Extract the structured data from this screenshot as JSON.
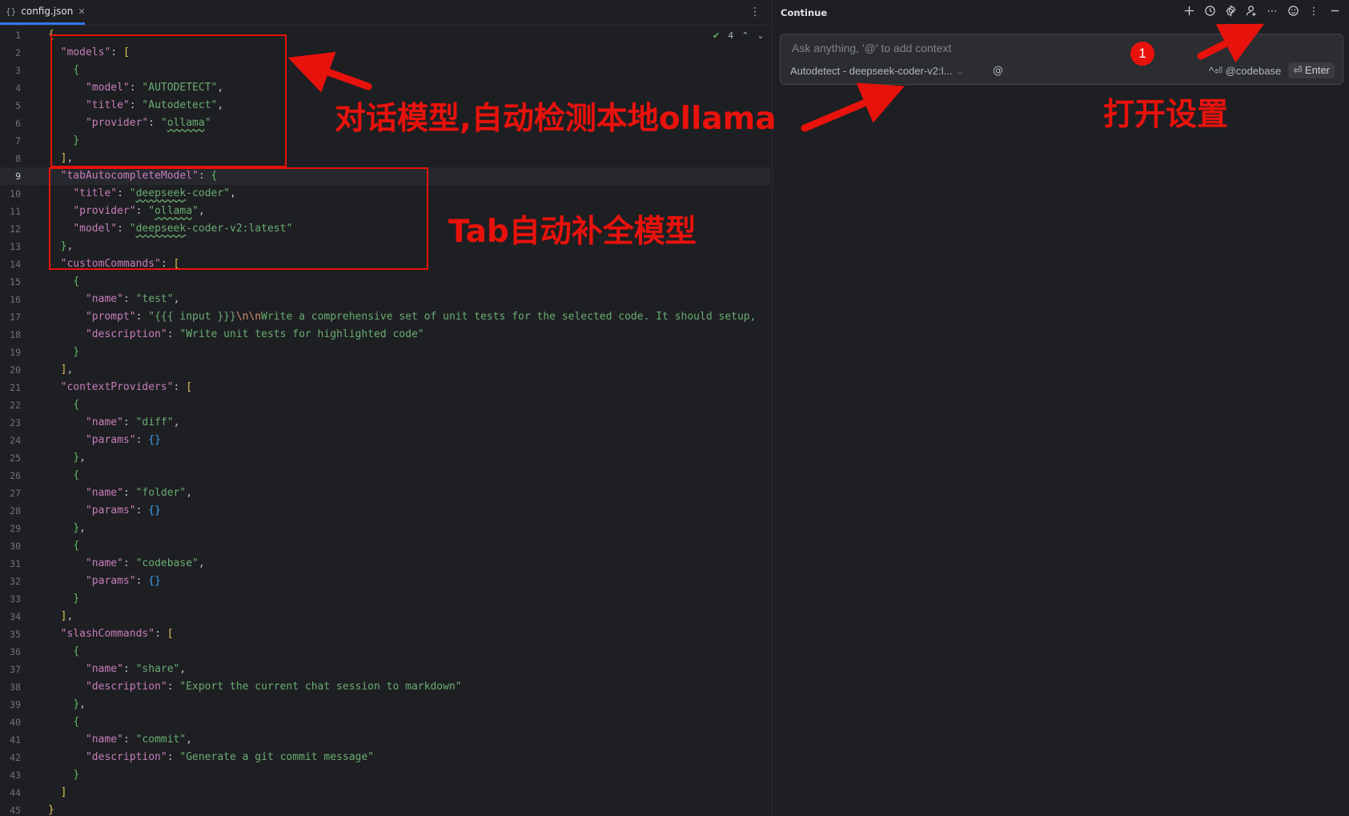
{
  "editor": {
    "tab": {
      "icon": "{}",
      "label": "config.json"
    },
    "inspection": {
      "count": "4"
    },
    "current_line": 9,
    "lines": [
      [
        [
          "b1",
          "{"
        ]
      ],
      [
        [
          "p",
          "  "
        ],
        [
          "k",
          "\"models\""
        ],
        [
          "p",
          ": "
        ],
        [
          "b1",
          "["
        ]
      ],
      [
        [
          "p",
          "    "
        ],
        [
          "b2",
          "{"
        ]
      ],
      [
        [
          "p",
          "      "
        ],
        [
          "k",
          "\"model\""
        ],
        [
          "p",
          ": "
        ],
        [
          "s",
          "\"AUTODETECT\""
        ],
        [
          "p",
          ","
        ]
      ],
      [
        [
          "p",
          "      "
        ],
        [
          "k",
          "\"title\""
        ],
        [
          "p",
          ": "
        ],
        [
          "s",
          "\"Autodetect\""
        ],
        [
          "p",
          ","
        ]
      ],
      [
        [
          "p",
          "      "
        ],
        [
          "k",
          "\"provider\""
        ],
        [
          "p",
          ": "
        ],
        [
          "s",
          "\""
        ],
        [
          "s sq",
          "ollama"
        ],
        [
          "s",
          "\""
        ]
      ],
      [
        [
          "p",
          "    "
        ],
        [
          "b2",
          "}"
        ]
      ],
      [
        [
          "p",
          "  "
        ],
        [
          "b1",
          "]"
        ],
        [
          "p",
          ","
        ]
      ],
      [
        [
          "p",
          "  "
        ],
        [
          "k",
          "\"tabAutocompleteModel\""
        ],
        [
          "p",
          ": "
        ],
        [
          "b2",
          "{"
        ]
      ],
      [
        [
          "p",
          "    "
        ],
        [
          "k",
          "\"title\""
        ],
        [
          "p",
          ": "
        ],
        [
          "s",
          "\""
        ],
        [
          "s sq",
          "deepseek"
        ],
        [
          "s",
          "-coder\""
        ],
        [
          "p",
          ","
        ]
      ],
      [
        [
          "p",
          "    "
        ],
        [
          "k",
          "\"provider\""
        ],
        [
          "p",
          ": "
        ],
        [
          "s",
          "\""
        ],
        [
          "s sq",
          "ollama"
        ],
        [
          "s",
          "\""
        ],
        [
          "p",
          ","
        ]
      ],
      [
        [
          "p",
          "    "
        ],
        [
          "k",
          "\"model\""
        ],
        [
          "p",
          ": "
        ],
        [
          "s",
          "\""
        ],
        [
          "s sq",
          "deepseek"
        ],
        [
          "s",
          "-coder-v2:latest\""
        ]
      ],
      [
        [
          "p",
          "  "
        ],
        [
          "b2",
          "}"
        ],
        [
          "p",
          ","
        ]
      ],
      [
        [
          "p",
          "  "
        ],
        [
          "k",
          "\"customCommands\""
        ],
        [
          "p",
          ": "
        ],
        [
          "b1",
          "["
        ]
      ],
      [
        [
          "p",
          "    "
        ],
        [
          "b2",
          "{"
        ]
      ],
      [
        [
          "p",
          "      "
        ],
        [
          "k",
          "\"name\""
        ],
        [
          "p",
          ": "
        ],
        [
          "s",
          "\"test\""
        ],
        [
          "p",
          ","
        ]
      ],
      [
        [
          "p",
          "      "
        ],
        [
          "k",
          "\"prompt\""
        ],
        [
          "p",
          ": "
        ],
        [
          "s",
          "\"{{{ input }}}"
        ],
        [
          "esc",
          "\\n\\n"
        ],
        [
          "s",
          "Write a comprehensive set of unit tests for the selected code. It should setup,"
        ]
      ],
      [
        [
          "p",
          "      "
        ],
        [
          "k",
          "\"description\""
        ],
        [
          "p",
          ": "
        ],
        [
          "s",
          "\"Write unit tests for highlighted code\""
        ]
      ],
      [
        [
          "p",
          "    "
        ],
        [
          "b2",
          "}"
        ]
      ],
      [
        [
          "p",
          "  "
        ],
        [
          "b1",
          "]"
        ],
        [
          "p",
          ","
        ]
      ],
      [
        [
          "p",
          "  "
        ],
        [
          "k",
          "\"contextProviders\""
        ],
        [
          "p",
          ": "
        ],
        [
          "b1",
          "["
        ]
      ],
      [
        [
          "p",
          "    "
        ],
        [
          "b2",
          "{"
        ]
      ],
      [
        [
          "p",
          "      "
        ],
        [
          "k",
          "\"name\""
        ],
        [
          "p",
          ": "
        ],
        [
          "s",
          "\"diff\""
        ],
        [
          "p",
          ","
        ]
      ],
      [
        [
          "p",
          "      "
        ],
        [
          "k",
          "\"params\""
        ],
        [
          "p",
          ": "
        ],
        [
          "b3",
          "{}"
        ]
      ],
      [
        [
          "p",
          "    "
        ],
        [
          "b2",
          "}"
        ],
        [
          "p",
          ","
        ]
      ],
      [
        [
          "p",
          "    "
        ],
        [
          "b2",
          "{"
        ]
      ],
      [
        [
          "p",
          "      "
        ],
        [
          "k",
          "\"name\""
        ],
        [
          "p",
          ": "
        ],
        [
          "s",
          "\"folder\""
        ],
        [
          "p",
          ","
        ]
      ],
      [
        [
          "p",
          "      "
        ],
        [
          "k",
          "\"params\""
        ],
        [
          "p",
          ": "
        ],
        [
          "b3",
          "{}"
        ]
      ],
      [
        [
          "p",
          "    "
        ],
        [
          "b2",
          "}"
        ],
        [
          "p",
          ","
        ]
      ],
      [
        [
          "p",
          "    "
        ],
        [
          "b2",
          "{"
        ]
      ],
      [
        [
          "p",
          "      "
        ],
        [
          "k",
          "\"name\""
        ],
        [
          "p",
          ": "
        ],
        [
          "s",
          "\"codebase\""
        ],
        [
          "p",
          ","
        ]
      ],
      [
        [
          "p",
          "      "
        ],
        [
          "k",
          "\"params\""
        ],
        [
          "p",
          ": "
        ],
        [
          "b3",
          "{}"
        ]
      ],
      [
        [
          "p",
          "    "
        ],
        [
          "b2",
          "}"
        ]
      ],
      [
        [
          "p",
          "  "
        ],
        [
          "b1",
          "]"
        ],
        [
          "p",
          ","
        ]
      ],
      [
        [
          "p",
          "  "
        ],
        [
          "k",
          "\"slashCommands\""
        ],
        [
          "p",
          ": "
        ],
        [
          "b1",
          "["
        ]
      ],
      [
        [
          "p",
          "    "
        ],
        [
          "b2",
          "{"
        ]
      ],
      [
        [
          "p",
          "      "
        ],
        [
          "k",
          "\"name\""
        ],
        [
          "p",
          ": "
        ],
        [
          "s",
          "\"share\""
        ],
        [
          "p",
          ","
        ]
      ],
      [
        [
          "p",
          "      "
        ],
        [
          "k",
          "\"description\""
        ],
        [
          "p",
          ": "
        ],
        [
          "s",
          "\"Export the current chat session to markdown\""
        ]
      ],
      [
        [
          "p",
          "    "
        ],
        [
          "b2",
          "}"
        ],
        [
          "p",
          ","
        ]
      ],
      [
        [
          "p",
          "    "
        ],
        [
          "b2",
          "{"
        ]
      ],
      [
        [
          "p",
          "      "
        ],
        [
          "k",
          "\"name\""
        ],
        [
          "p",
          ": "
        ],
        [
          "s",
          "\"commit\""
        ],
        [
          "p",
          ","
        ]
      ],
      [
        [
          "p",
          "      "
        ],
        [
          "k",
          "\"description\""
        ],
        [
          "p",
          ": "
        ],
        [
          "s",
          "\"Generate a git commit message\""
        ]
      ],
      [
        [
          "p",
          "    "
        ],
        [
          "b2",
          "}"
        ]
      ],
      [
        [
          "p",
          "  "
        ],
        [
          "b1",
          "]"
        ]
      ],
      [
        [
          "b1",
          "}"
        ]
      ]
    ]
  },
  "panel": {
    "title": "Continue",
    "icons": [
      "plus-icon",
      "history-icon",
      "settings-gear-icon",
      "add-user-icon",
      "more-horizontal-icon",
      "emoji-icon",
      "more-vertical-icon",
      "minimize-icon"
    ],
    "chat": {
      "placeholder": "Ask anything, '@' to add context",
      "model": "Autodetect - deepseek-coder-v2:l...",
      "at": "@",
      "codebase": "^⏎ @codebase",
      "enter": "⏎ Enter"
    }
  },
  "annotations": {
    "chat_model": "对话模型,自动检测本地ollama",
    "tab_model": "Tab自动补全模型",
    "open_settings": "打开设置",
    "badge": "1",
    "color": "#e8120c"
  }
}
